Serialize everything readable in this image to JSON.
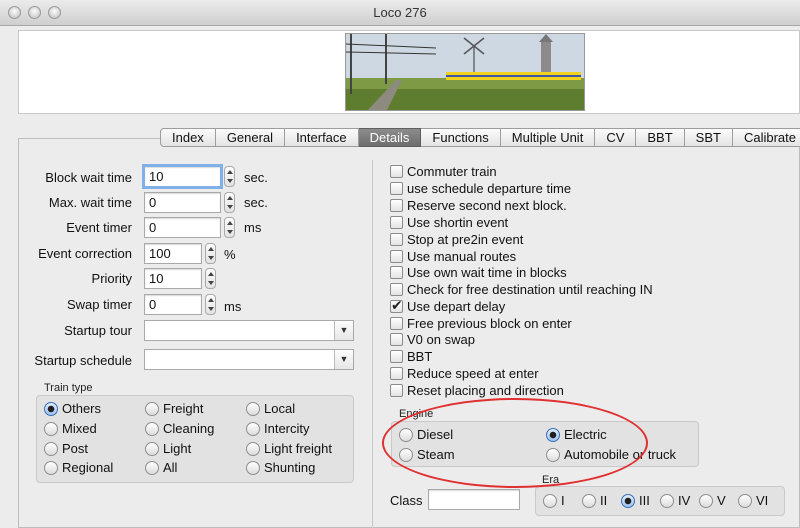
{
  "window": {
    "title": "Loco 276"
  },
  "tabs": [
    "Index",
    "General",
    "Interface",
    "Details",
    "Functions",
    "Multiple Unit",
    "CV",
    "BBT",
    "SBT",
    "Calibrate"
  ],
  "active_tab": "Details",
  "fields": {
    "block_wait_time": {
      "label": "Block wait time",
      "value": "10",
      "unit": "sec."
    },
    "max_wait_time": {
      "label": "Max. wait time",
      "value": "0",
      "unit": "sec."
    },
    "event_timer": {
      "label": "Event timer",
      "value": "0",
      "unit": "ms"
    },
    "event_correction": {
      "label": "Event correction",
      "value": "100",
      "unit": "%"
    },
    "priority": {
      "label": "Priority",
      "value": "10"
    },
    "swap_timer": {
      "label": "Swap timer",
      "value": "0",
      "unit": "ms"
    },
    "startup_tour": {
      "label": "Startup tour",
      "value": ""
    },
    "startup_schedule": {
      "label": "Startup schedule",
      "value": ""
    }
  },
  "train_type": {
    "title": "Train type",
    "options": [
      "Others",
      "Freight",
      "Local",
      "Mixed",
      "Cleaning",
      "Intercity",
      "Post",
      "Light",
      "Light freight",
      "Regional",
      "All",
      "Shunting"
    ],
    "selected": "Others"
  },
  "checkboxes": [
    {
      "label": "Commuter train",
      "checked": false
    },
    {
      "label": "use schedule departure time",
      "checked": false
    },
    {
      "label": "Reserve second next block.",
      "checked": false
    },
    {
      "label": "Use shortin event",
      "checked": false
    },
    {
      "label": "Stop at pre2in event",
      "checked": false
    },
    {
      "label": "Use manual routes",
      "checked": false
    },
    {
      "label": "Use own wait time in blocks",
      "checked": false
    },
    {
      "label": "Check for free destination until reaching IN",
      "checked": false
    },
    {
      "label": "Use depart delay",
      "checked": true
    },
    {
      "label": "Free previous block on enter",
      "checked": false
    },
    {
      "label": "V0 on swap",
      "checked": false
    },
    {
      "label": "BBT",
      "checked": false
    },
    {
      "label": "Reduce speed at enter",
      "checked": false
    },
    {
      "label": "Reset placing and direction",
      "checked": false
    }
  ],
  "engine": {
    "title": "Engine",
    "options": [
      "Diesel",
      "Electric",
      "Steam",
      "Automobile or truck"
    ],
    "selected": "Electric"
  },
  "class": {
    "label": "Class",
    "value": ""
  },
  "era": {
    "title": "Era",
    "options": [
      "I",
      "II",
      "III",
      "IV",
      "V",
      "VI"
    ],
    "selected": "III"
  },
  "colors": {
    "highlight": "#e03030",
    "active_tab": "#7a7a7a",
    "focus": "#7fb0e8"
  }
}
